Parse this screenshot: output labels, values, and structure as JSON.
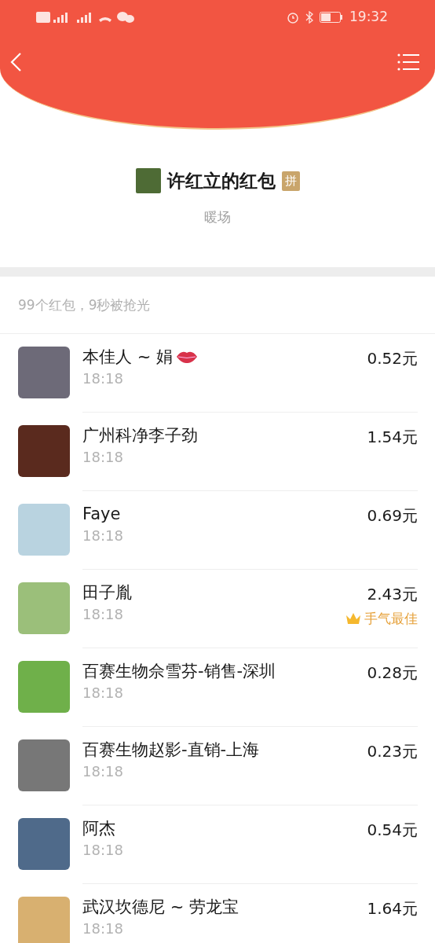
{
  "status_bar": {
    "time": "19:32"
  },
  "packet": {
    "title": "许红立的红包",
    "tag": "拼",
    "subtitle": "暖场"
  },
  "summary": "99个红包，9秒被抢光",
  "best_label": "手气最佳",
  "rows": [
    {
      "name": "本佳人 ~ 娟",
      "emoji": true,
      "time": "18:18",
      "amount": "0.52元",
      "best": false
    },
    {
      "name": "广州科净李子劲",
      "emoji": false,
      "time": "18:18",
      "amount": "1.54元",
      "best": false
    },
    {
      "name": "Faye",
      "emoji": false,
      "time": "18:18",
      "amount": "0.69元",
      "best": false
    },
    {
      "name": "田子胤",
      "emoji": false,
      "time": "18:18",
      "amount": "2.43元",
      "best": true
    },
    {
      "name": "百赛生物佘雪芬-销售-深圳",
      "emoji": false,
      "time": "18:18",
      "amount": "0.28元",
      "best": false
    },
    {
      "name": "百赛生物赵影-直销-上海",
      "emoji": false,
      "time": "18:18",
      "amount": "0.23元",
      "best": false
    },
    {
      "name": "阿杰",
      "emoji": false,
      "time": "18:18",
      "amount": "0.54元",
      "best": false
    },
    {
      "name": "武汉坎德尼 ~ 劳龙宝",
      "emoji": false,
      "time": "18:18",
      "amount": "1.64元",
      "best": false
    }
  ]
}
